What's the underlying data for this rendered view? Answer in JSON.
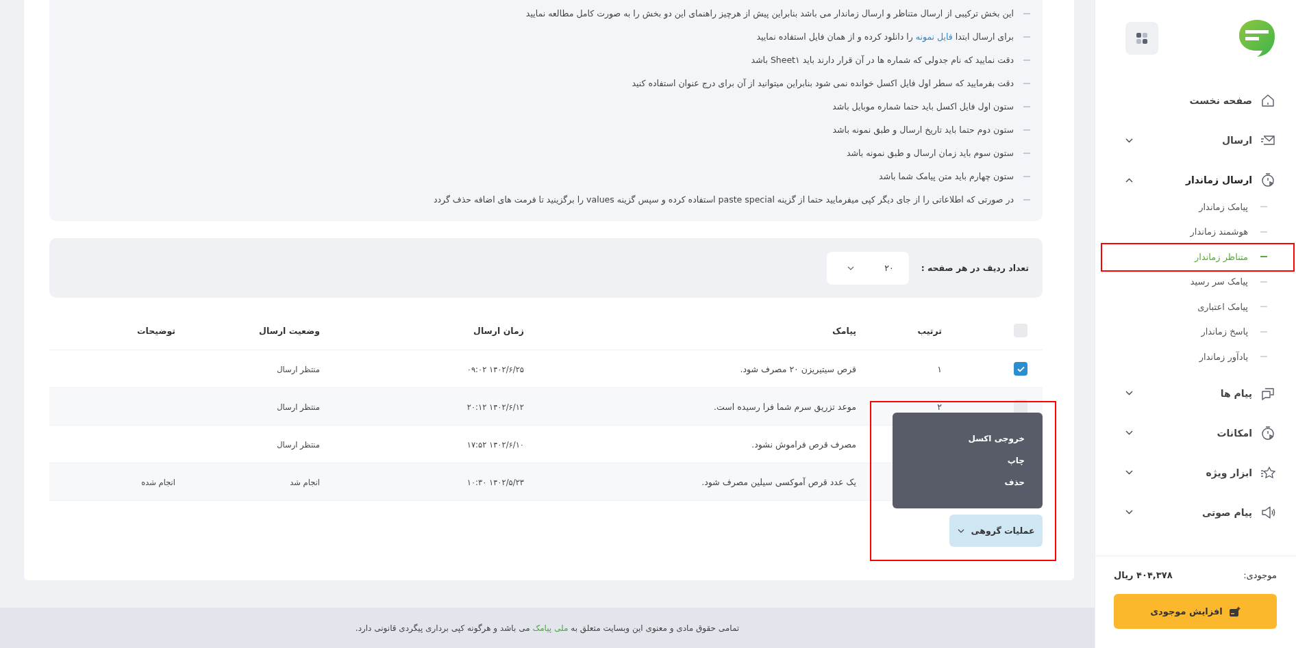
{
  "guidelines": [
    {
      "before": "این بخش ترکیبی از ارسال متناظر و ارسال زماندار می باشد بنابراین پیش از هرچیز راهنمای این دو بخش را به صورت کامل مطالعه نمایید"
    },
    {
      "before": "برای ارسال ابتدا",
      "link": "فایل نمونه",
      "after": "را دانلود کرده و از همان فایل استفاده نمایید"
    },
    {
      "before": "دقت نمایید که نام جدولی که شماره ها در آن قرار دارند باید Sheet۱ باشد"
    },
    {
      "before": "دقت بفرمایید که سطر اول فایل اکسل خوانده نمی شود بنابراین میتوانید از آن برای درج عنوان استفاده کنید"
    },
    {
      "before": "ستون اول فایل اکسل باید حتما شماره موبایل باشد"
    },
    {
      "before": "ستون دوم حتما باید تاریخ ارسال و طبق نمونه باشد"
    },
    {
      "before": "ستون سوم باید زمان ارسال و طبق نمونه باشد"
    },
    {
      "before": "ستون چهارم باید متن پیامک شما باشد"
    },
    {
      "before": "در صورتی که اطلاعاتی را از جای دیگر کپی میفرمایید حتما از گزینه paste special استفاده کرده و سپس گزینه values را برگزینید تا فرمت های اضافه حذف گردد"
    }
  ],
  "page_size": {
    "label": "تعداد ردیف در هر صفحه :",
    "value": "۲۰"
  },
  "table": {
    "all_selected": false,
    "columns": [
      "ترتیب",
      "پیامک",
      "زمان ارسال",
      "وضعیت ارسال",
      "توضیحات"
    ],
    "rows": [
      {
        "selected": true,
        "index": "۱",
        "message": "قرص سیتیریزن ۲۰ مصرف شود.",
        "time": "۱۴۰۲/۶/۲۵ ۰۹:۰۲",
        "status": "منتظر ارسال",
        "notes": ""
      },
      {
        "selected": false,
        "index": "۲",
        "message": "موعد تزریق سرم شما فرا رسیده است.",
        "time": "۱۴۰۲/۶/۱۲ ۲۰:۱۲",
        "status": "منتظر ارسال",
        "notes": ""
      },
      {
        "index": "",
        "message": "مصرف قرص فراموش نشود.",
        "time": "۱۴۰۲/۶/۱۰ ۱۷:۵۲",
        "status": "منتظر ارسال",
        "notes": ""
      },
      {
        "index": "",
        "message": "یک عدد قرص آموکسی سیلین مصرف شود.",
        "time": "۱۴۰۲/۵/۲۳ ۱۰:۳۰",
        "status": "انجام شد",
        "notes": "انجام شده"
      }
    ]
  },
  "bulk_actions": {
    "label": "عملیات گروهی",
    "expanded": true,
    "highlighted": true,
    "menu": [
      "خروجی اکسل",
      "چاپ",
      "حذف"
    ]
  },
  "footer": {
    "before": "تمامی حقوق مادی و معنوی این وبسایت متعلق به",
    "link": "ملی پیامک",
    "after": "می باشد و هرگونه کپی برداری پیگردی قانونی دارد."
  },
  "sidebar": {
    "nav": [
      {
        "label": "صفحه نخست"
      },
      {
        "label": "ارسال",
        "expanded": false
      },
      {
        "label": "ارسال زماندار",
        "expanded": true,
        "children": [
          {
            "label": "پیامک زماندار",
            "selected": false,
            "highlighted": false
          },
          {
            "label": "هوشمند زماندار",
            "selected": false,
            "highlighted": false
          },
          {
            "label": "متناظر زماندار",
            "selected": true,
            "highlighted": true
          },
          {
            "label": "پیامک سر رسید",
            "selected": false,
            "highlighted": false
          },
          {
            "label": "پیامک اعتباری",
            "selected": false,
            "highlighted": false
          },
          {
            "label": "پاسخ زماندار",
            "selected": false,
            "highlighted": false
          },
          {
            "label": "یادآور زماندار",
            "selected": false,
            "highlighted": false
          }
        ]
      },
      {
        "label": "پیام ها",
        "expanded": false
      },
      {
        "label": "امکانات",
        "expanded": false
      },
      {
        "label": "ابزار ویژه",
        "expanded": false
      },
      {
        "label": "پیام صوتی",
        "expanded": false
      }
    ],
    "balance_label": "موجودی:",
    "balance": "۴۰۴,۳۷۸ ریال",
    "topup": "افزایش موجودی"
  }
}
